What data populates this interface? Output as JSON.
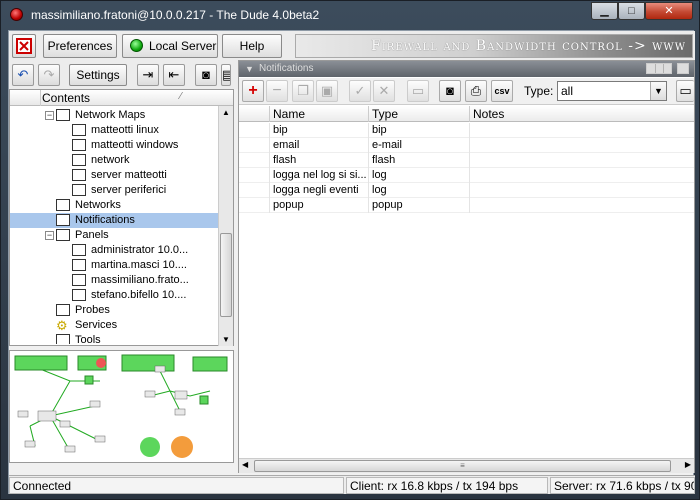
{
  "window": {
    "title": "massimiliano.fratoni@10.0.0.217 - The Dude 4.0beta2",
    "minimize_glyph": "▁",
    "maximize_glyph": "□",
    "close_glyph": "✕"
  },
  "menu": {
    "preferences": "Preferences",
    "local_server": "Local Server",
    "help": "Help",
    "settings": "Settings"
  },
  "banner": "Firewall and Bandwidth control -> www",
  "tree": {
    "header": "Contents",
    "items": [
      {
        "label": "Network Maps",
        "level": 1,
        "expand": "−"
      },
      {
        "label": "matteotti linux",
        "level": 2
      },
      {
        "label": "matteotti windows",
        "level": 2
      },
      {
        "label": "network",
        "level": 2
      },
      {
        "label": "server matteotti",
        "level": 2
      },
      {
        "label": "server periferici",
        "level": 2
      },
      {
        "label": "Networks",
        "level": 1
      },
      {
        "label": "Notifications",
        "level": 1,
        "selected": true
      },
      {
        "label": "Panels",
        "level": 1,
        "expand": "−"
      },
      {
        "label": "administrator 10.0...",
        "level": 2
      },
      {
        "label": "martina.masci 10....",
        "level": 2
      },
      {
        "label": "massimiliano.frato...",
        "level": 2
      },
      {
        "label": "stefano.bifello 10....",
        "level": 2
      },
      {
        "label": "Probes",
        "level": 1
      },
      {
        "label": "Services",
        "level": 1,
        "icon": "gear"
      },
      {
        "label": "Tools",
        "level": 1
      }
    ]
  },
  "panel": {
    "title": "Notifications",
    "type_label": "Type:",
    "type_value": "all",
    "csv_label": "csv"
  },
  "grid": {
    "columns": [
      "Name",
      "Type",
      "Notes"
    ],
    "rows": [
      {
        "name": "bip",
        "type": "bip",
        "notes": ""
      },
      {
        "name": "email",
        "type": "e-mail",
        "notes": ""
      },
      {
        "name": "flash",
        "type": "flash",
        "notes": ""
      },
      {
        "name": "logga nel log si si...",
        "type": "log",
        "notes": ""
      },
      {
        "name": "logga negli eventi",
        "type": "log",
        "notes": ""
      },
      {
        "name": "popup",
        "type": "popup",
        "notes": ""
      }
    ]
  },
  "status": {
    "connection": "Connected",
    "client": "Client: rx 16.8 kbps / tx 194 bps",
    "server": "Server: rx 71.6 kbps / tx 90..."
  },
  "colors": {
    "selected": "#a9c7ec",
    "add": "#d40000",
    "node_green": "#5cd65c",
    "node_orange": "#f39c3c"
  }
}
